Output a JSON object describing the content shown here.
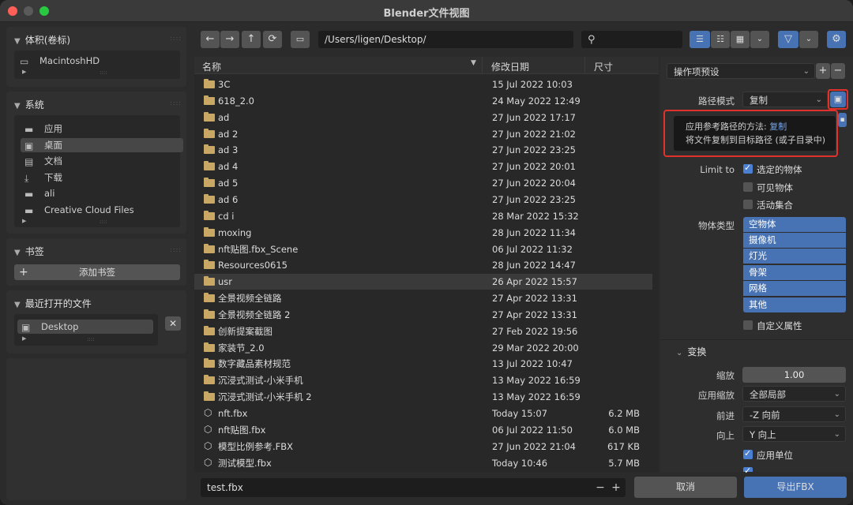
{
  "window": {
    "title": "Blender文件视图"
  },
  "sidebar": {
    "volumes": {
      "header": "体积(卷标)",
      "items": [
        {
          "label": "MacintoshHD",
          "icon": "drive-icon"
        }
      ]
    },
    "system": {
      "header": "系统",
      "items": [
        {
          "label": "应用",
          "icon": "folder-icon"
        },
        {
          "label": "桌面",
          "icon": "desktop-icon"
        },
        {
          "label": "文档",
          "icon": "document-icon"
        },
        {
          "label": "下载",
          "icon": "download-icon"
        },
        {
          "label": "ali",
          "icon": "folder-icon"
        },
        {
          "label": "Creative Cloud Files",
          "icon": "folder-icon"
        }
      ]
    },
    "bookmarks": {
      "header": "书签",
      "add_label": "添加书签"
    },
    "recent": {
      "header": "最近打开的文件",
      "items": [
        {
          "label": "Desktop"
        }
      ]
    }
  },
  "toolbar": {
    "path": "/Users/ligen/Desktop/",
    "search_value": ""
  },
  "filelist": {
    "headers": {
      "name": "名称",
      "date": "修改日期",
      "size": "尺寸"
    },
    "rows": [
      {
        "name": "3C",
        "date": "15 Jul 2022 10:03",
        "size": "",
        "type": "folder"
      },
      {
        "name": "618_2.0",
        "date": "24 May 2022 12:49",
        "size": "",
        "type": "folder"
      },
      {
        "name": "ad",
        "date": "27 Jun 2022 17:17",
        "size": "",
        "type": "folder"
      },
      {
        "name": "ad 2",
        "date": "27 Jun 2022 21:02",
        "size": "",
        "type": "folder"
      },
      {
        "name": "ad 3",
        "date": "27 Jun 2022 23:25",
        "size": "",
        "type": "folder"
      },
      {
        "name": "ad 4",
        "date": "27 Jun 2022 20:01",
        "size": "",
        "type": "folder"
      },
      {
        "name": "ad 5",
        "date": "27 Jun 2022 20:04",
        "size": "",
        "type": "folder"
      },
      {
        "name": "ad 6",
        "date": "27 Jun 2022 23:25",
        "size": "",
        "type": "folder"
      },
      {
        "name": "cd i",
        "date": "28 Mar 2022 15:32",
        "size": "",
        "type": "folder"
      },
      {
        "name": "moxing",
        "date": "28 Jun 2022 11:34",
        "size": "",
        "type": "folder"
      },
      {
        "name": "nft贴图.fbx_Scene",
        "date": "06 Jul 2022 11:32",
        "size": "",
        "type": "folder"
      },
      {
        "name": "Resources0615",
        "date": "28 Jun 2022 14:47",
        "size": "",
        "type": "folder"
      },
      {
        "name": "usr",
        "date": "26 Apr 2022 15:57",
        "size": "",
        "type": "folder"
      },
      {
        "name": "全景视频全链路",
        "date": "27 Apr 2022 13:31",
        "size": "",
        "type": "folder"
      },
      {
        "name": "全景视频全链路 2",
        "date": "27 Apr 2022 13:31",
        "size": "",
        "type": "folder"
      },
      {
        "name": "创新提案截图",
        "date": "27 Feb 2022 19:56",
        "size": "",
        "type": "folder"
      },
      {
        "name": "家装节_2.0",
        "date": "29 Mar 2022 20:00",
        "size": "",
        "type": "folder"
      },
      {
        "name": "数字藏品素材规范",
        "date": "13 Jul 2022 10:47",
        "size": "",
        "type": "folder"
      },
      {
        "name": "沉浸式测试-小米手机",
        "date": "13 May 2022 16:59",
        "size": "",
        "type": "folder"
      },
      {
        "name": "沉浸式测试-小米手机 2",
        "date": "13 May 2022 16:59",
        "size": "",
        "type": "folder"
      },
      {
        "name": "nft.fbx",
        "date": "Today 15:07",
        "size": "6.2 MB",
        "type": "file"
      },
      {
        "name": "nft贴图.fbx",
        "date": "06 Jul 2022 11:50",
        "size": "6.0 MB",
        "type": "file"
      },
      {
        "name": "模型比例参考.FBX",
        "date": "27 Jun 2022 21:04",
        "size": "617 KB",
        "type": "file"
      },
      {
        "name": "测试模型.fbx",
        "date": "Today 10:46",
        "size": "5.7 MB",
        "type": "file"
      }
    ]
  },
  "bottom": {
    "filename": "test.fbx",
    "cancel_label": "取消",
    "export_label": "导出FBX"
  },
  "props": {
    "preset_label": "操作项预设",
    "path_mode": {
      "label": "路径模式",
      "value": "复制"
    },
    "tooltip": {
      "line1_prefix": "应用参考路径的方法:",
      "line1_value": "复制",
      "line2": "将文件复制到目标路径 (或子目录中)"
    },
    "limit_to": {
      "label": "Limit to",
      "options": [
        {
          "label": "选定的物体",
          "checked": true
        },
        {
          "label": "可见物体",
          "checked": false
        },
        {
          "label": "活动集合",
          "checked": false
        }
      ]
    },
    "object_types": {
      "label": "物体类型",
      "items": [
        "空物体",
        "摄像机",
        "灯光",
        "骨架",
        "网格",
        "其他"
      ]
    },
    "custom_props": {
      "label": "自定义属性",
      "checked": false
    },
    "transform": {
      "header": "变换",
      "scale": {
        "label": "缩放",
        "value": "1.00"
      },
      "apply_scaling": {
        "label": "应用缩放",
        "value": "全部局部"
      },
      "forward": {
        "label": "前进",
        "value": "-Z 向前"
      },
      "up": {
        "label": "向上",
        "value": "Y 向上"
      },
      "apply_unit": {
        "label": "应用单位",
        "checked": true
      }
    }
  },
  "colors": {
    "accent": "#4772b3",
    "highlight": "#e0322b",
    "folder": "#c9a865"
  }
}
